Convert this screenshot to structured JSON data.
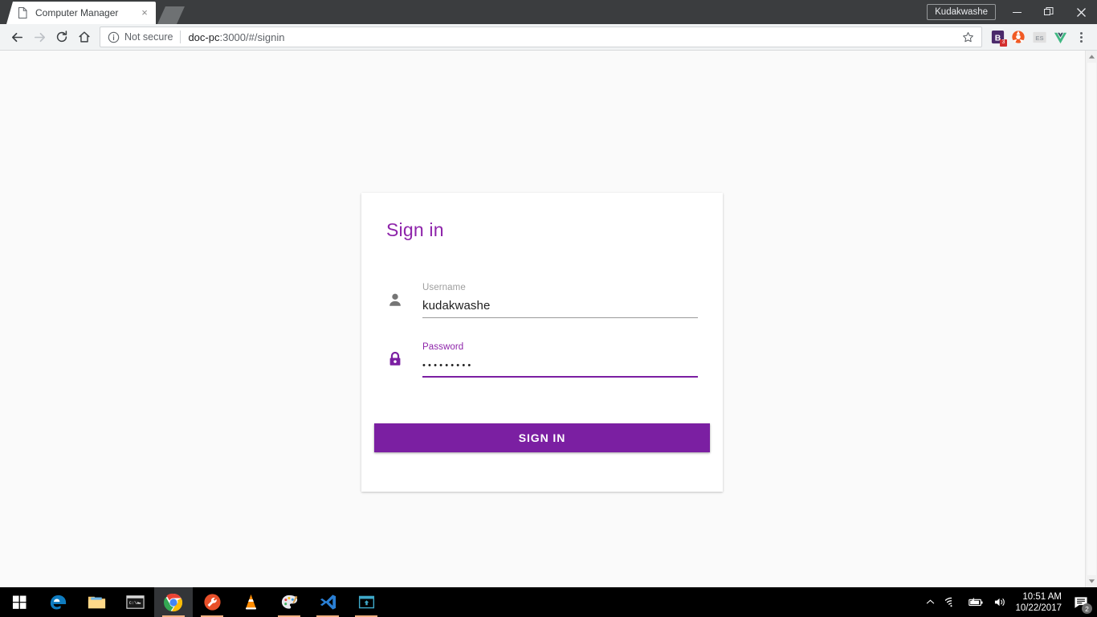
{
  "browser": {
    "tab": {
      "title": "Computer Manager",
      "favicon": "page-icon",
      "close": "×"
    },
    "new_tab_label": "",
    "window": {
      "profile": "Kudakwashe",
      "minimize": "–",
      "maximize": "❐",
      "close": "✕"
    },
    "toolbar": {
      "back": "←",
      "forward": "→",
      "reload": "↻",
      "home": "⌂",
      "security_label": "Not secure",
      "url_host": "doc-pc",
      "url_rest": ":3000/#/signin",
      "bookmark": "☆",
      "extensions": [
        {
          "name": "bitwarden-extension",
          "label": "B",
          "badge": "3",
          "color": "#ffffff",
          "bg": "#4b2a6b"
        },
        {
          "name": "orange-extension",
          "label": "",
          "badge": "",
          "color": "#ffffff",
          "bg": "#f15a24"
        },
        {
          "name": "es-extension",
          "label": "ES",
          "badge": "",
          "color": "#9aa0a6",
          "bg": "#e0e0e0"
        },
        {
          "name": "vue-devtools-extension",
          "label": "V",
          "badge": "",
          "color": "#41b883",
          "bg": "transparent"
        }
      ],
      "menu": "chrome-menu-icon"
    },
    "scrollbar": {
      "up": "▲",
      "down": "▼"
    }
  },
  "signin": {
    "title": "Sign in",
    "username": {
      "icon": "person-icon",
      "label": "Username",
      "value": "kudakwashe",
      "placeholder": "Username",
      "focused": false
    },
    "password": {
      "icon": "lock-icon",
      "label": "Password",
      "value": "•••••••••",
      "placeholder": "Password",
      "focused": true
    },
    "submit_label": "SIGN IN",
    "accent_color": "#7b1fa2",
    "title_color": "#8e24aa"
  },
  "taskbar": {
    "start": "windows-start-icon",
    "apps": [
      {
        "name": "edge",
        "running": false,
        "active": false
      },
      {
        "name": "file-explorer",
        "running": false,
        "active": false
      },
      {
        "name": "command-prompt",
        "running": false,
        "active": false
      },
      {
        "name": "chrome",
        "running": true,
        "active": true
      },
      {
        "name": "tool-app",
        "running": true,
        "active": false
      },
      {
        "name": "vlc-media-player",
        "running": false,
        "active": false
      },
      {
        "name": "paint",
        "running": true,
        "active": false
      },
      {
        "name": "visual-studio",
        "running": true,
        "active": false
      },
      {
        "name": "terminal-app",
        "running": true,
        "active": false
      }
    ],
    "tray": {
      "show_hidden": "˄",
      "network": "wifi-icon",
      "battery": "battery-icon",
      "volume": "speaker-icon",
      "time": "10:51 AM",
      "date": "10/22/2017",
      "action_center": "action-center-icon",
      "notification_count": "2"
    }
  }
}
